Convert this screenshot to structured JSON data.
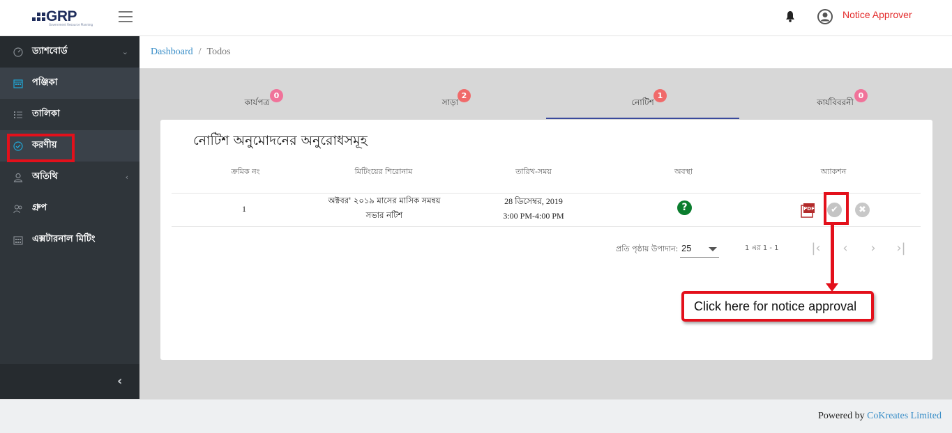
{
  "header": {
    "logo_text": "GRP",
    "logo_subtext": "Government Resource Planning",
    "user_name": "Notice Approver"
  },
  "sidebar": {
    "items": [
      {
        "label": "ড্যাশবোর্ড",
        "icon": "gauge-icon"
      },
      {
        "label": "পঞ্জিকা",
        "icon": "calendar-icon"
      },
      {
        "label": "তালিকা",
        "icon": "list-icon"
      },
      {
        "label": "করণীয়",
        "icon": "check-circle-icon"
      },
      {
        "label": "অতিথি",
        "icon": "user-icon"
      },
      {
        "label": "গ্রুপ",
        "icon": "users-icon"
      },
      {
        "label": "এক্সটারনাল মিটিং",
        "icon": "calendar-grid-icon"
      }
    ]
  },
  "breadcrumb": {
    "root": "Dashboard",
    "separator": "/",
    "current": "Todos"
  },
  "tabs": [
    {
      "label": "কার্যপত্র",
      "count": "0"
    },
    {
      "label": "সাড়া",
      "count": "2"
    },
    {
      "label": "নোটিশ",
      "count": "1"
    },
    {
      "label": "কার্যবিবরনী",
      "count": "0"
    }
  ],
  "card": {
    "title": "নোটিশ অনুমোদনের অনুরোধসমূহ",
    "columns": [
      "ক্রমিক নং",
      "মিটিংয়ের শিরোনাম",
      "তারিখ-সময়",
      "অবস্থা",
      "অ্যাকশন"
    ],
    "rows": [
      {
        "serial": "1",
        "title_line1": "অক্টবর' ২০১৯ মাসের মাসিক সমন্বয়",
        "title_line2": "সভার নটিশ",
        "date": "28 ডিসেম্বর, 2019",
        "time": "3:00 PM-4:00 PM",
        "status_icon": "?"
      }
    ]
  },
  "pager": {
    "per_page_label": "প্রতি পৃষ্ঠায় উপাদান:",
    "per_page_value": "25",
    "range": "1 এর 1 - 1"
  },
  "annotation": {
    "callout_text": "Click here for notice approval"
  },
  "footer": {
    "prefix": "Powered by",
    "company": "CoKreates Limited"
  },
  "colors": {
    "sidebar_bg": "#2f353a",
    "accent_blue": "#3b8fc8",
    "badge_pink": "#f0739a",
    "status_green": "#0b7d2e",
    "annotation_red": "#e3101b"
  }
}
